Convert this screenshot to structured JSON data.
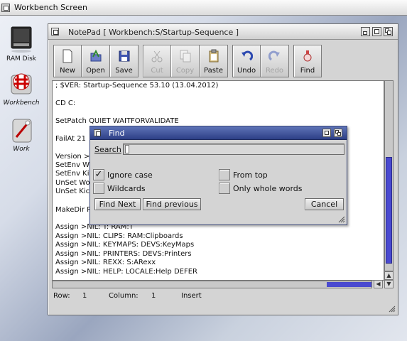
{
  "screen": {
    "title": "Workbench Screen"
  },
  "desktop": {
    "icons": [
      {
        "label": "RAM Disk"
      },
      {
        "label": "Workbench"
      },
      {
        "label": "Work"
      }
    ]
  },
  "window": {
    "title": "NotePad [ Workbench:S/Startup-Sequence ]",
    "toolbar": {
      "buttons": [
        {
          "label": "New",
          "icon": "new-file-icon",
          "enabled": true
        },
        {
          "label": "Open",
          "icon": "open-folder-icon",
          "enabled": true
        },
        {
          "label": "Save",
          "icon": "save-disk-icon",
          "enabled": true
        },
        {
          "label": "Cut",
          "icon": "scissors-icon",
          "enabled": false
        },
        {
          "label": "Copy",
          "icon": "copy-icon",
          "enabled": false
        },
        {
          "label": "Paste",
          "icon": "paste-clipboard-icon",
          "enabled": true
        },
        {
          "label": "Undo",
          "icon": "undo-icon",
          "enabled": true
        },
        {
          "label": "Redo",
          "icon": "redo-icon",
          "enabled": false
        },
        {
          "label": "Find",
          "icon": "find-icon",
          "enabled": true
        }
      ]
    },
    "editor": {
      "lines": [
        "; $VER: Startup-Sequence 53.10 (13.04.2012)",
        "",
        "CD C:",
        "",
        "SetPatch QUIET WAITFORVALIDATE",
        "",
        "FailAt 21",
        "",
        "Version >",
        "SetEnv W",
        "SetEnv Ki",
        "UnSet Wo",
        "UnSet Kic",
        "",
        "MakeDir R",
        "",
        "Assign >NIL: T: RAM:T",
        "Assign >NIL: CLIPS: RAM:Clipboards",
        "Assign >NIL: KEYMAPS: DEVS:KeyMaps",
        "Assign >NIL: PRINTERS: DEVS:Printers",
        "Assign >NIL: REXX: S:ARexx",
        "Assign >NIL: HELP: LOCALE:Help DEFER"
      ]
    },
    "status": {
      "row_label": "Row:",
      "row_value": "1",
      "column_label": "Column:",
      "column_value": "1",
      "mode": "Insert"
    }
  },
  "find_dialog": {
    "title": "Find",
    "search_label": "Search",
    "search_value": "",
    "options": [
      {
        "label": "Ignore case",
        "checked": true
      },
      {
        "label": "From top",
        "checked": false
      },
      {
        "label": "Wildcards",
        "checked": false
      },
      {
        "label": "Only whole words",
        "checked": false
      }
    ],
    "buttons": {
      "find_next": "Find Next",
      "find_previous": "Find previous",
      "cancel": "Cancel"
    }
  },
  "colors": {
    "scroll_knob": "#4a4ad0",
    "dialog_title": "#2d3f86"
  }
}
